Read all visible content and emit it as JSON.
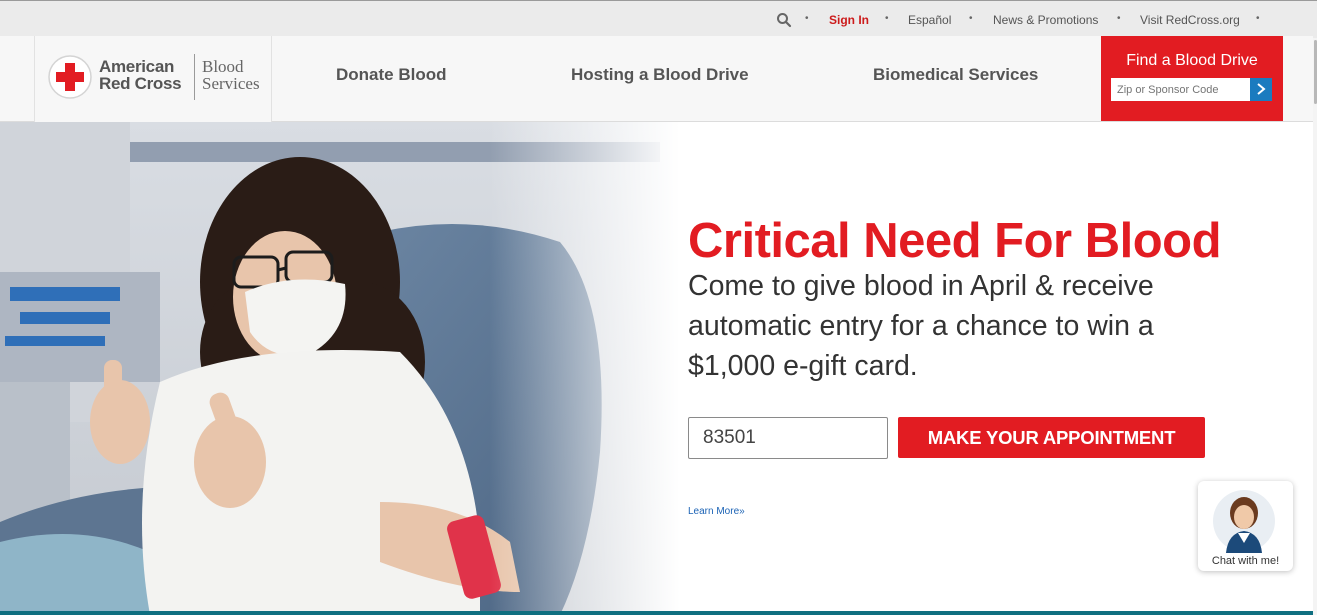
{
  "utility_bar": {
    "search_icon": "search-icon",
    "sign_in": "Sign In",
    "espanol": "Español",
    "news": "News & Promotions",
    "visit": "Visit RedCross.org",
    "separator": "•"
  },
  "logo": {
    "line1": "American",
    "line2": "Red Cross",
    "sub1": "Blood",
    "sub2": "Services"
  },
  "nav": {
    "items": [
      {
        "label": "Donate Blood"
      },
      {
        "label": "Hosting a Blood Drive"
      },
      {
        "label": "Biomedical Services"
      }
    ]
  },
  "find_drive": {
    "title": "Find a Blood Drive",
    "placeholder": "Zip or Sponsor Code",
    "go_icon": "chevron-right-icon"
  },
  "hero": {
    "title": "Critical Need For Blood",
    "subtitle": "Come to give blood in April & receive automatic entry for a chance to win a $1,000 e-gift card.",
    "zip_value": "83501",
    "button": "MAKE YOUR APPOINTMENT",
    "learn_more": "Learn More»"
  },
  "chat": {
    "label": "Chat with me!"
  },
  "colors": {
    "brand_red": "#e21c22",
    "link_blue": "#1a62b5",
    "go_blue": "#1a7bbf"
  }
}
